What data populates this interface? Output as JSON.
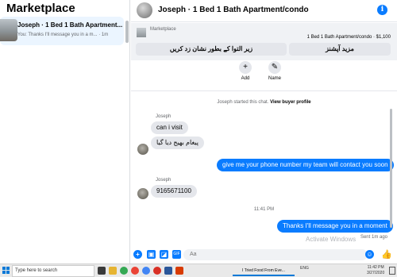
{
  "sidebar": {
    "title": "Marketplace",
    "conversation": {
      "name": "Joseph · 1 Bed 1 Bath Apartment...",
      "preview": "You: Thanks I'll message you in a m... · 1m"
    }
  },
  "header": {
    "title": "Joseph · 1 Bed 1 Bath Apartment/condo"
  },
  "marketplace": {
    "label": "Marketplace",
    "listing": "1 Bed 1 Bath Apartment/condo · $1,100",
    "button_pending": "زیر التوا کے بطور نشان زد کریں",
    "button_more": "مزید آپشنز"
  },
  "actions": {
    "add": "Add",
    "name": "Name"
  },
  "system": {
    "prefix": "Joseph started this chat.",
    "link": "View buyer profile"
  },
  "messages": [
    {
      "sender": "Joseph",
      "text": "can i visit"
    },
    {
      "text": "پیغام بھیج دیا گیا"
    },
    {
      "text": "give me your phone number my team will contact you soon"
    },
    {
      "sender": "Joseph",
      "text": "9165671100"
    },
    {
      "time": "11:41 PM"
    },
    {
      "text": "Thanks I'll message you in a moment"
    }
  ],
  "status": {
    "seen": "Sent 1m ago",
    "watermark": "Activate Windows"
  },
  "composer": {
    "placeholder": "Aa"
  },
  "taskbar": {
    "search": "Type here to search",
    "task": "I Tried Food From Eve...",
    "tray": "ENG",
    "time": "11:42 PM",
    "date": "3/27/2020"
  },
  "colors": {
    "accent": "#0a7cff",
    "incoming": "#e4e6eb",
    "selected": "#ebf5ff"
  }
}
